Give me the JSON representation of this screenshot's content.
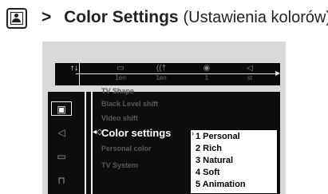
{
  "heading": {
    "arrow": ">",
    "title": "Color Settings",
    "subtitle": "(Ustawienia kolorów)",
    "icon": "tv-person-icon"
  },
  "topbar": {
    "items": [
      {
        "icon": "settings-tools-icon",
        "glyph": "↑↓",
        "value": ""
      },
      {
        "icon": "subtitle-icon",
        "glyph": "▭",
        "value": "1en"
      },
      {
        "icon": "audio-icon",
        "glyph": "((†",
        "value": "1en"
      },
      {
        "icon": "angle-icon",
        "glyph": "◉",
        "value": "1"
      },
      {
        "icon": "sound-mode-icon",
        "glyph": "◁",
        "value": "st"
      }
    ]
  },
  "sidebar": {
    "items": [
      {
        "icon": "tv-picture-icon",
        "glyph": "▣"
      },
      {
        "icon": "speaker-icon",
        "glyph": "◁"
      },
      {
        "icon": "language-speech-icon",
        "glyph": "▭"
      },
      {
        "icon": "preferences-icon",
        "glyph": "⊓"
      }
    ]
  },
  "menu": {
    "items": [
      {
        "label": "TV Shape"
      },
      {
        "label": "Black Level shift"
      },
      {
        "label": "Video shift"
      },
      {
        "label": "Color settings"
      },
      {
        "label": "Personal color"
      },
      {
        "label": "TV System"
      }
    ],
    "active_index": 3,
    "cursor": "◂◇"
  },
  "submenu": {
    "items": [
      {
        "label": "1 Personal"
      },
      {
        "label": "2 Rich"
      },
      {
        "label": "3 Natural"
      },
      {
        "label": "4 Soft"
      },
      {
        "label": "5 Animation"
      }
    ]
  },
  "colors": {
    "panel": "#d9d9d9",
    "osd_background": "#0d0d0d",
    "submenu_background": "#ffffff"
  }
}
